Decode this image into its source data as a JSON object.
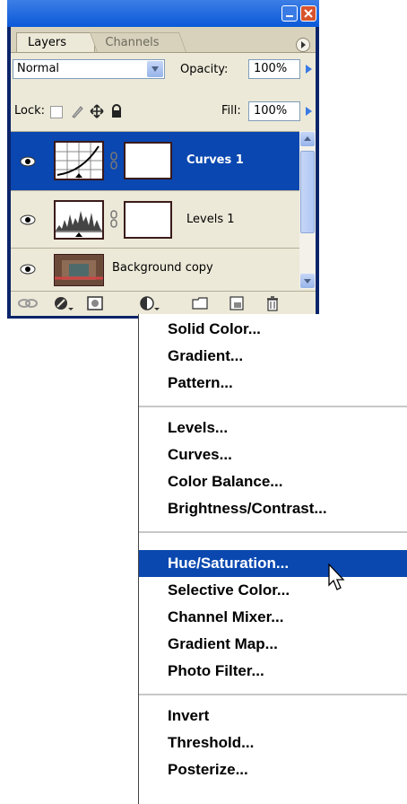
{
  "panel": {
    "tabs": [
      "Layers",
      "Channels"
    ],
    "blend_mode": "Normal",
    "opacity_label": "Opacity:",
    "opacity_value": "100%",
    "lock_label": "Lock:",
    "fill_label": "Fill:",
    "fill_value": "100%",
    "layers": [
      {
        "name": "Curves 1",
        "selected": true
      },
      {
        "name": "Levels 1",
        "selected": false
      },
      {
        "name": "Background copy",
        "selected": false
      }
    ]
  },
  "menu": {
    "groups": [
      [
        "Solid Color...",
        "Gradient...",
        "Pattern..."
      ],
      [
        "Levels...",
        "Curves...",
        "Color Balance...",
        "Brightness/Contrast..."
      ],
      [
        "Hue/Saturation...",
        "Selective Color...",
        "Channel Mixer...",
        "Gradient Map...",
        "Photo Filter..."
      ],
      [
        "Invert",
        "Threshold...",
        "Posterize..."
      ]
    ],
    "highlighted": "Hue/Saturation..."
  },
  "colors": {
    "selection": "#0a47b0",
    "panel_bg": "#ece9d8",
    "titlebar": "#0a59d8"
  }
}
